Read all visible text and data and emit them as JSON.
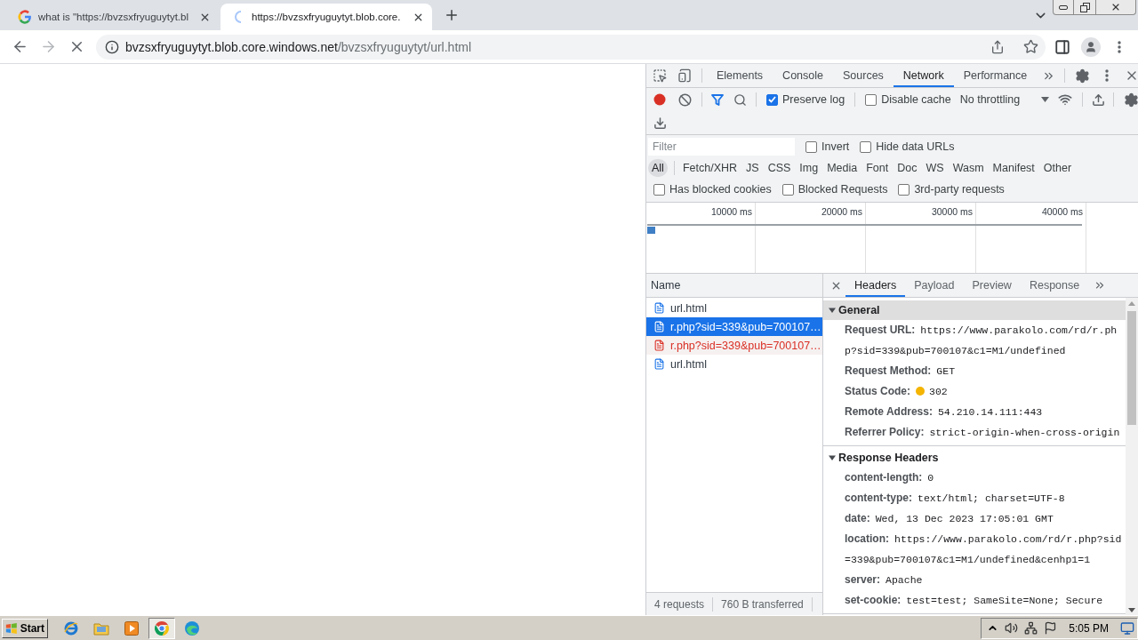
{
  "browser_tabs": [
    {
      "title": "what is \"https://bvzsxfryuguytyt.bl",
      "selected": false,
      "loading": false
    },
    {
      "title": "https://bvzsxfryuguytyt.blob.core.",
      "selected": true,
      "loading": true
    }
  ],
  "address_bar": {
    "host": "bvzsxfryuguytyt.blob.core.windows.net",
    "path": "/bvzsxfryuguytyt/url.html",
    "loading": true
  },
  "devtools": {
    "panel_tabs": [
      {
        "label": "Elements",
        "selected": false
      },
      {
        "label": "Console",
        "selected": false
      },
      {
        "label": "Sources",
        "selected": false
      },
      {
        "label": "Network",
        "selected": true
      },
      {
        "label": "Performance",
        "selected": false
      }
    ],
    "toolbar": {
      "recording": true,
      "preserve_log": {
        "label": "Preserve log",
        "checked": true
      },
      "disable_cache": {
        "label": "Disable cache",
        "checked": false
      },
      "throttling": "No throttling"
    },
    "filter": {
      "placeholder": "Filter",
      "options": [
        {
          "label": "Invert",
          "checked": false
        },
        {
          "label": "Hide data URLs",
          "checked": false
        }
      ]
    },
    "type_filters": [
      {
        "label": "All",
        "selected": true
      },
      {
        "label": "Fetch/XHR",
        "selected": false
      },
      {
        "label": "JS",
        "selected": false
      },
      {
        "label": "CSS",
        "selected": false
      },
      {
        "label": "Img",
        "selected": false
      },
      {
        "label": "Media",
        "selected": false
      },
      {
        "label": "Font",
        "selected": false
      },
      {
        "label": "Doc",
        "selected": false
      },
      {
        "label": "WS",
        "selected": false
      },
      {
        "label": "Wasm",
        "selected": false
      },
      {
        "label": "Manifest",
        "selected": false
      },
      {
        "label": "Other",
        "selected": false
      }
    ],
    "extra_filters": [
      {
        "label": "Has blocked cookies",
        "checked": false
      },
      {
        "label": "Blocked Requests",
        "checked": false
      },
      {
        "label": "3rd-party requests",
        "checked": false
      }
    ],
    "overview": {
      "ticks": [
        "10000 ms",
        "20000 ms",
        "30000 ms",
        "40000 ms"
      ]
    },
    "requests": {
      "column": "Name",
      "rows": [
        {
          "name": "url.html",
          "selected": false,
          "failed": false
        },
        {
          "name": "r.php?sid=339&pub=700107…",
          "selected": true,
          "failed": false
        },
        {
          "name": "r.php?sid=339&pub=700107…",
          "selected": false,
          "failed": true
        },
        {
          "name": "url.html",
          "selected": false,
          "failed": false
        }
      ]
    },
    "summary": [
      "4 requests",
      "760 B transferred"
    ],
    "detail_tabs": [
      {
        "label": "Headers",
        "selected": true
      },
      {
        "label": "Payload",
        "selected": false
      },
      {
        "label": "Preview",
        "selected": false
      },
      {
        "label": "Response",
        "selected": false
      }
    ],
    "sections": [
      {
        "title": "General",
        "highlighted": true,
        "expanded": true,
        "rows": [
          {
            "label": "Request URL:",
            "value": "https://www.parakolo.com/rd/r.php?sid=339&pub=700107&c1=M1/undefined"
          },
          {
            "label": "Request Method:",
            "value": "GET"
          },
          {
            "label": "Status Code:",
            "value": "302",
            "color": "#f4b400"
          },
          {
            "label": "Remote Address:",
            "value": "54.210.14.111:443"
          },
          {
            "label": "Referrer Policy:",
            "value": "strict-origin-when-cross-origin"
          }
        ]
      },
      {
        "title": "Response Headers",
        "highlighted": false,
        "expanded": true,
        "rows": [
          {
            "label": "content-length:",
            "value": "0"
          },
          {
            "label": "content-type:",
            "value": "text/html; charset=UTF-8"
          },
          {
            "label": "date:",
            "value": "Wed, 13 Dec 2023 17:05:01 GMT"
          },
          {
            "label": "location:",
            "value": "https://www.parakolo.com/rd/r.php?sid=339&pub=700107&c1=M1/undefined&cenhp1=1"
          },
          {
            "label": "server:",
            "value": "Apache"
          },
          {
            "label": "set-cookie:",
            "value": "test=test; SameSite=None; Secure"
          }
        ]
      }
    ]
  },
  "taskbar": {
    "start": "Start",
    "apps": [
      {
        "kind": "ie",
        "selected": false
      },
      {
        "kind": "folder",
        "selected": false
      },
      {
        "kind": "media",
        "selected": false
      },
      {
        "kind": "chrome",
        "selected": true
      },
      {
        "kind": "edge",
        "selected": false
      }
    ],
    "clock": "5:05 PM"
  }
}
